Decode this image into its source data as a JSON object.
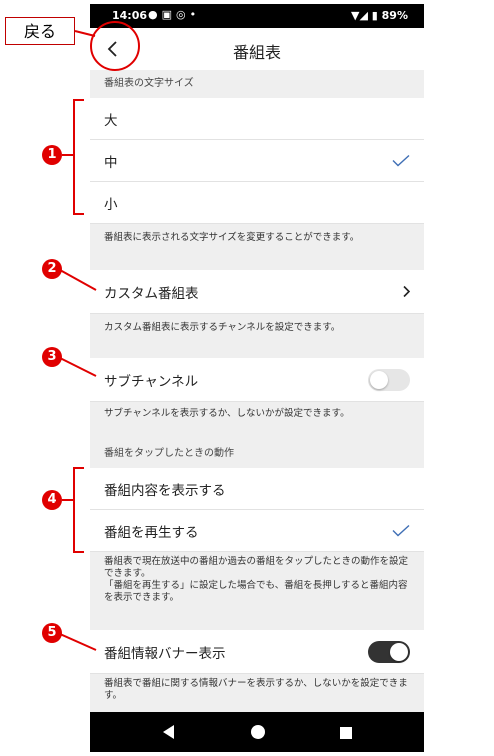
{
  "callouts": {
    "back_label": "戻る",
    "badges": [
      "1",
      "2",
      "3",
      "4",
      "5"
    ]
  },
  "status_bar": {
    "time": "14:06",
    "battery": "89%",
    "icons": [
      "message-icon",
      "image-icon",
      "chrome-icon",
      "dot-icon",
      "wifi-icon",
      "signal-icon",
      "battery-icon"
    ]
  },
  "app_bar": {
    "title": "番組表"
  },
  "font_size": {
    "header": "番組表の文字サイズ",
    "options": [
      {
        "label": "大",
        "selected": false
      },
      {
        "label": "中",
        "selected": true
      },
      {
        "label": "小",
        "selected": false
      }
    ],
    "description": "番組表に表示される文字サイズを変更することができます。"
  },
  "custom": {
    "label": "カスタム番組表",
    "description": "カスタム番組表に表示するチャンネルを設定できます。"
  },
  "sub_channel": {
    "label": "サブチャンネル",
    "enabled": false,
    "description": "サブチャンネルを表示するか、しないかが設定できます。"
  },
  "tap_action": {
    "header": "番組をタップしたときの動作",
    "options": [
      {
        "label": "番組内容を表示する",
        "selected": false
      },
      {
        "label": "番組を再生する",
        "selected": true
      }
    ],
    "description_1": "番組表で現在放送中の番組か過去の番組をタップしたときの動作を設定できます。",
    "description_2": "「番組を再生する」に設定した場合でも、番組を長押しすると番組内容を表示できます。"
  },
  "banner": {
    "label": "番組情報バナー表示",
    "enabled": true,
    "description": "番組表で番組に関する情報バナーを表示するか、しないかを設定できます。"
  },
  "colors": {
    "accent": "#3f6fb5",
    "toggle_on": "#333333",
    "toggle_off": "#e6e6e6",
    "callout_red": "#e00000"
  }
}
